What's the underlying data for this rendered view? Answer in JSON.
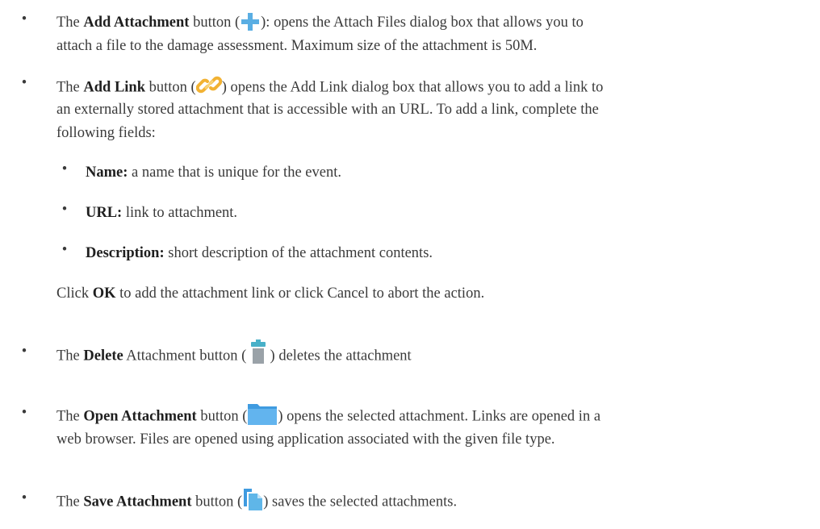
{
  "bullet_char": "•",
  "items": {
    "add_attachment": {
      "pre": "The ",
      "bold": "Add Attachment",
      "mid": " button (",
      "post": "): opens the Attach Files dialog box that allows you to",
      "line2": "attach a file to the damage assessment. Maximum size of the attachment is 50M."
    },
    "add_link": {
      "pre": "The ",
      "bold": "Add Link",
      "mid": " button (",
      "post": ") opens the Add Link dialog box that allows you to add a link to",
      "line2": "an externally stored attachment that is accessible with an URL. To add a link, complete the",
      "line3": "following fields:"
    },
    "fields": [
      {
        "label": "Name:",
        "text": " a name that is unique for the event."
      },
      {
        "label": "URL:",
        "text": " link to attachment."
      },
      {
        "label": "Description:",
        "text": " short description of the attachment contents."
      }
    ],
    "click_ok": {
      "pre": "Click ",
      "bold": "OK",
      "post": " to add the attachment link or click Cancel to abort the action."
    },
    "delete": {
      "pre": "The ",
      "bold": "Delete",
      "mid": " Attachment button ( ",
      "post": " ) deletes the attachment"
    },
    "open": {
      "pre": "The ",
      "bold": "Open Attachment",
      "mid": " button (",
      "post": ") opens the selected attachment. Links are opened in a",
      "line2": "web browser. Files are opened using application associated with the given file type."
    },
    "save": {
      "pre": "The ",
      "bold": "Save Attachment",
      "mid": " button (",
      "post": ") saves the selected attachments."
    }
  },
  "icons": {
    "add": "plus-icon",
    "link": "chain-link-icon",
    "delete": "trash-icon",
    "open": "folder-icon",
    "save": "save-files-icon"
  },
  "colors": {
    "plus": "#5aaee3",
    "link": "#f2b233",
    "trash_lid": "#48b0c8",
    "trash_body": "#9aa2a8",
    "folder": "#3f9be0",
    "save": "#5fb6e8"
  }
}
